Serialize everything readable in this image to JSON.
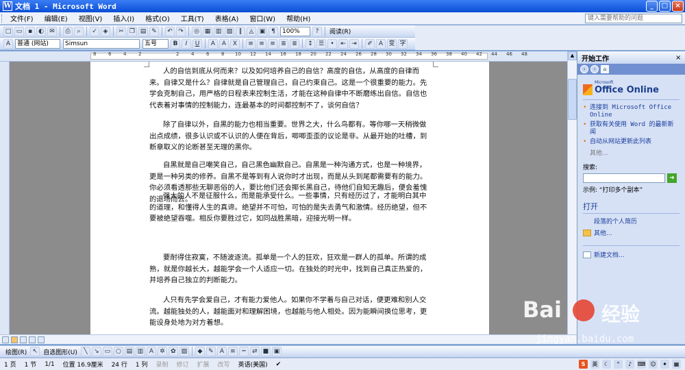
{
  "window": {
    "title": "文档 1 - Microsoft Word",
    "app_icon": "W",
    "minimize": "_",
    "maximize": "□",
    "close": "×"
  },
  "menu": {
    "items": [
      "文件(F)",
      "编辑(E)",
      "视图(V)",
      "插入(I)",
      "格式(O)",
      "工具(T)",
      "表格(A)",
      "窗口(W)",
      "帮助(H)"
    ],
    "help_placeholder": "键入需要帮助的问题"
  },
  "toolbar": {
    "zoom": "100%",
    "read_label": "阅读(R)",
    "style": "普通 (网站)",
    "font": "Simsun",
    "size": "五号"
  },
  "ruler": {
    "labels": [
      "8",
      "6",
      "4",
      "2",
      "2",
      "4",
      "6",
      "8",
      "10",
      "12",
      "14",
      "16",
      "18",
      "20",
      "22",
      "24",
      "26",
      "28",
      "30",
      "32",
      "34",
      "36",
      "38",
      "40",
      "42",
      "44",
      "46",
      "48"
    ]
  },
  "document": {
    "paragraphs": [
      "人的自信到底从何而来？以及如何培养自己的自信？高度的自信，从高度的自律而来。自律又是什么？自律就是自己管理自己，自己约束自己。这是一个很重要的能力。先学会克制自己，用严格的日程表来控制生活，才能在这种自律中不断磨练出自信。自信也代表着对事情的控制能力，连最基本的时间都控制不了，谈何自信？",
      "除了自律以外，自黑的能力也相当重要。世界之大，什么鸟都有。等你哪一天稍微做出点成绩，很多认识或不认识的人便在背后，唧唧歪歪的议论是非。从最开始的吐槽，到断章取义的论断甚至无理的黑你。",
      "自黑就是自己嘲笑自己，自己黑色幽默自己。自黑是一种沟通方式，也是一种境界，更是一种另类的修养。自黑不是等到有人说你时才出现，而是从头到尾都需要有的能力。你必须看透那些无聊恶俗的人，要比他们还会揶长黑自己，待他们自知无趣后，便会羞愧的退场而去。",
      "强大的人不是征服什么，而是能承受什么。一些事情，只有经历过了，才能明白其中的道理，和懂得人生的真谛。绝望并不可怕，可怕的是失去勇气和激情。经历绝望，但不要被绝望吞噬。相反你要胜过它，如同战胜黑暗，迎接光明一样。",
      "要耐得住寂寞，不随波逐流。孤单是一个人的狂欢，狂欢是一群人的孤单。所谓的成熟，就是你越长大，越能学会一个人适应一切。在独处的时光中，找到自己真正热爱的，并培养自己独立的判断能力。",
      "人只有先学会爱自己，才有能力爱他人。如果你不学着与自己对话，便更难和别人交流。越能独处的人，越能面对和理解困境，也越能与他人相处。因为能瞬间换位思考，更能设身处地为对方着想。"
    ]
  },
  "drawing": {
    "draw_label": "绘图(R)",
    "autoshape_label": "自选图形(U)"
  },
  "status": {
    "page": "1 页",
    "section": "1 节",
    "page_of": "1/1",
    "position": "位置 16.9厘米",
    "line": "24 行",
    "column": "1 列",
    "rec": "录制",
    "trk": "修订",
    "ext": "扩展",
    "ovr": "改写",
    "lang": "英语(美国)",
    "ime": "英"
  },
  "taskpane": {
    "title": "开始工作",
    "office_brand_small": "Microsoft",
    "office_brand": "Office Online",
    "links": [
      "连接到 Microsoft Office Online",
      "获取有关使用 Word 的最新新闻",
      "自动从网站更新此列表"
    ],
    "more": "其他...",
    "search_label": "搜索:",
    "example": "示例: “打印多个副本”",
    "open_title": "打开",
    "open_items": [
      "段落的个人简历",
      "其他..."
    ],
    "new_doc": "新建文档..."
  },
  "watermark": {
    "logo": "Bai",
    "logo2": "经验",
    "url": "jingyan.baidu.com"
  }
}
